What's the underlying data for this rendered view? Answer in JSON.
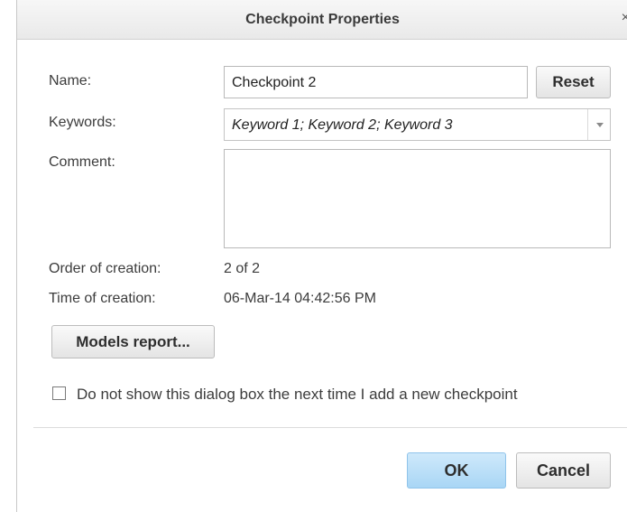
{
  "dialog": {
    "title": "Checkpoint Properties",
    "close_glyph": "×"
  },
  "form": {
    "name_label": "Name:",
    "name_value": "Checkpoint 2",
    "reset_label": "Reset",
    "keywords_label": "Keywords:",
    "keywords_value": "Keyword 1; Keyword 2; Keyword 3",
    "comment_label": "Comment:",
    "comment_value": "",
    "order_label": "Order of creation:",
    "order_value": "2 of 2",
    "time_label": "Time of creation:",
    "time_value": "06-Mar-14 04:42:56 PM"
  },
  "actions": {
    "models_report_label": "Models report...",
    "dont_show_label": "Do not show this dialog box the next time I add a new checkpoint",
    "dont_show_checked": false,
    "ok_label": "OK",
    "cancel_label": "Cancel"
  },
  "icons": {
    "close": "close-icon",
    "dropdown": "chevron-down-icon"
  },
  "colors": {
    "ok_button": "#a9d6f5",
    "title_bar": "#ececec"
  }
}
